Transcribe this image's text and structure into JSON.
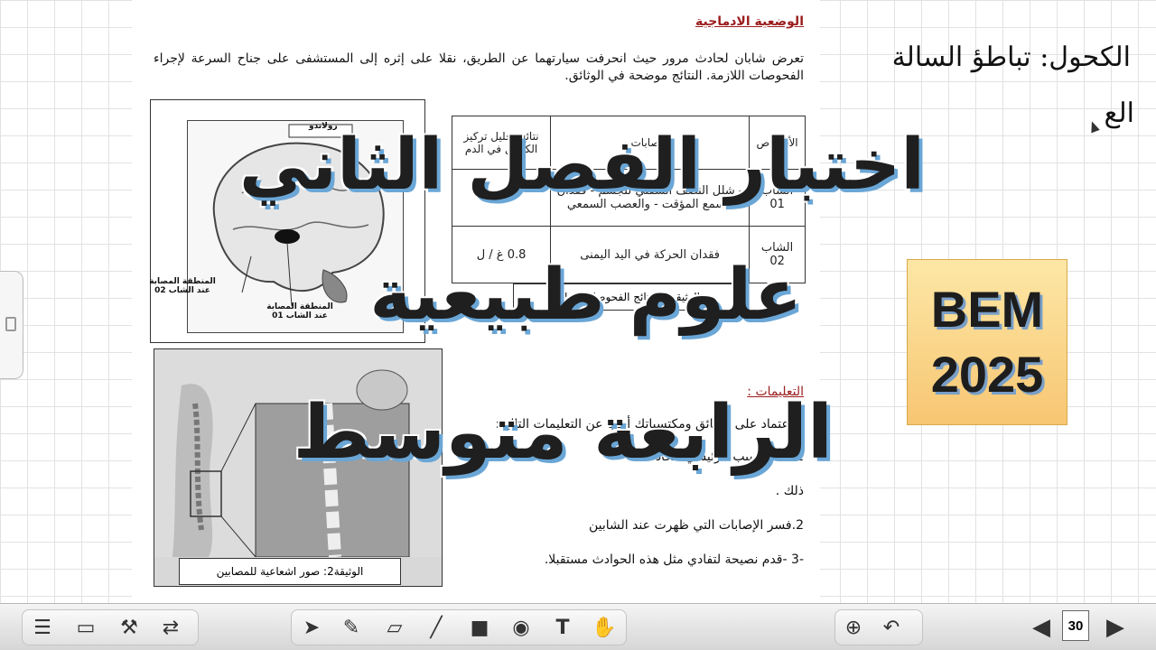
{
  "document": {
    "section_title": "الوضعية الادماجية",
    "intro": "تعرض شابان لحادث مرور حيث انحرفت سيارتهما عن الطريق، نقلا على إثره إلى المستشفى على جناح السرعة لإجراء الفحوصات اللازمة. النتائج موضحة في الوثائق.",
    "brain_labels": {
      "region_02": "المنطقة المصابة عند الشاب 02",
      "region_01": "المنطقة المصابة عند الشاب 01",
      "top": "رولاندو"
    },
    "table": {
      "headers": [
        "الأشخاص",
        "الإصابات",
        "نتائج تحليل تركيز الكحول في الدم"
      ],
      "rows": [
        [
          "الشاب 01",
          "- شلل النصف السفلي للجسم - فقدان السمع المؤقت - والعصب السمعي",
          ""
        ],
        [
          "الشاب 02",
          "فقدان الحركة في اليد اليمنى",
          "0.8 غ / ل"
        ]
      ],
      "caption": "الوثيقة 1: نتائج الفحوصات الطبية"
    },
    "xray_caption": "الوثيقة2: صور اشعاعية للمصابين",
    "instructions_title": "التعليمات :",
    "q_intro": "بالاعتماد على الوثائق ومكتسباتك أجب عن التعليمات التالية:",
    "q1": "1.حدد السبب الرئيسي للحادث",
    "q1b": "ذلك .",
    "q2": "2.فسر الإصابات التي ظهرت عند الشابين",
    "q3": "-3 -قدم نصيحة لتفادي مثل هذه الحوادث مستقبلا."
  },
  "handwriting": {
    "line1": "الكحول: تباطؤ السالة",
    "line2": "الع"
  },
  "overlay": {
    "line1": "اختبار الفصل الثاني",
    "line2": "علوم طبيعية",
    "line3": "الرابعة متوسط"
  },
  "badge": {
    "line1": "BEM",
    "line2": "2025"
  },
  "toolbar": {
    "page_number": "30"
  }
}
